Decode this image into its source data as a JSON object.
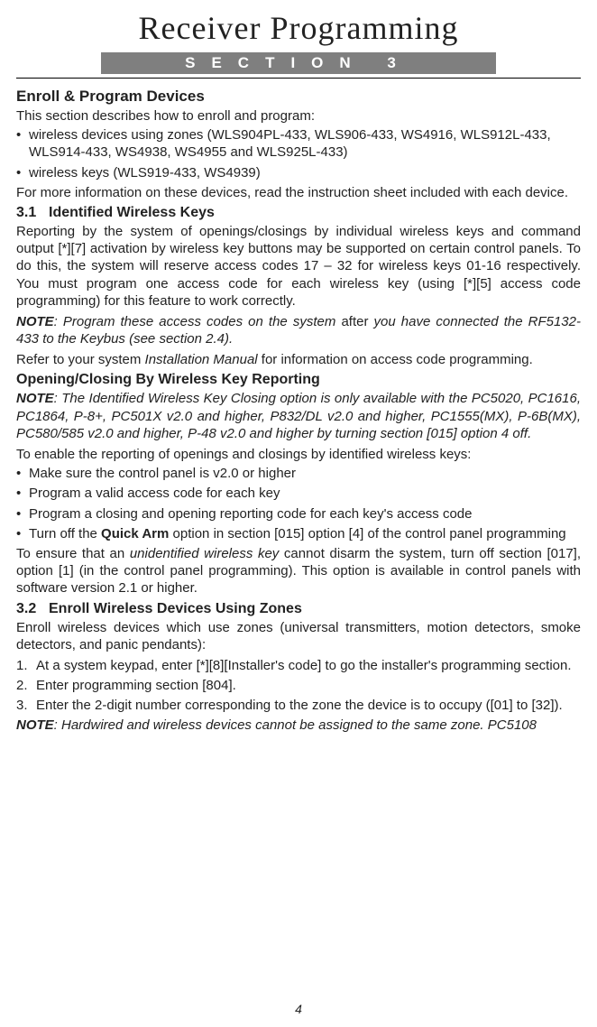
{
  "title": "Receiver Programming",
  "section_bar": "SECTION 3",
  "h_enroll": "Enroll & Program Devices",
  "p_intro": "This section describes how to enroll and program:",
  "b1": "wireless devices using zones (WLS904PL-433, WLS906-433,  WS4916, WLS912L-433, WLS914-433, WS4938, WS4955 and WLS925L-433)",
  "b2": "wireless keys (WLS919-433, WS4939)",
  "p_moreinfo": "For more information on these devices, read the instruction sheet included with each device.",
  "s31_num": "3.1",
  "s31_title": "Identified Wireless Keys",
  "s31_body": "Reporting by the system of openings/closings by individual wireless keys and command output [*][7] activation by wireless key buttons may be supported on certain control panels. To do this, the system will reserve access codes 17 – 32 for wireless keys 01-16 respectively. You must program one access code for each wireless key (using [*][5] access code programming) for this feature to work correctly.",
  "note1_label": "NOTE",
  "note1_a": ": Program these access codes on the system ",
  "note1_after": "after",
  "note1_b": " you have connected the RF5132-433  to the Keybus (see section 2.4).",
  "p_refer_a": "Refer to your system ",
  "p_refer_im": "Installation Manual",
  "p_refer_b": " for information on access code programming.",
  "h_openclose": "Opening/Closing By Wireless Key Reporting",
  "note2_label": "NOTE",
  "note2_body": ": The Identified Wireless Key Closing option is only available with the PC5020, PC1616, PC1864, P-8+,  PC501X v2.0 and higher, P832/DL v2.0 and higher, PC1555(MX), P-6B(MX), PC580/585 v2.0 and higher, P-48 v2.0 and higher by turning section [015] option 4 off.",
  "p_enable": "To enable the reporting of openings and closings by identified wireless keys:",
  "eb1": "Make sure the control panel is v2.0 or higher",
  "eb2": "Program a valid access code for each key",
  "eb3": "Program a closing and opening reporting code for each key's access code",
  "eb4_a": "Turn off the ",
  "eb4_qa": "Quick Arm",
  "eb4_b": " option in section [015] option [4] of the control panel programming",
  "p_ensure_a": "To ensure that an ",
  "p_ensure_i": "unidentified wireless key",
  "p_ensure_b": " cannot disarm the system, turn off section [017], option [1] (in the control panel programming). This option is available in control panels with software version 2.1 or higher.",
  "s32_num": "3.2",
  "s32_title": "Enroll Wireless Devices Using Zones",
  "s32_body": "Enroll wireless devices which use zones (universal transmitters, motion detectors, smoke detectors, and panic pendants):",
  "ol1": "At a system keypad, enter [*][8][Installer's code] to go the installer's programming section.",
  "ol2": "Enter programming section [804].",
  "ol3": "Enter the 2-digit number corresponding to the zone the device is to occupy ([01] to [32]).",
  "note3_label": "NOTE",
  "note3_body": ": Hardwired and wireless devices cannot be assigned to the same zone. PC5108",
  "page_number": "4"
}
